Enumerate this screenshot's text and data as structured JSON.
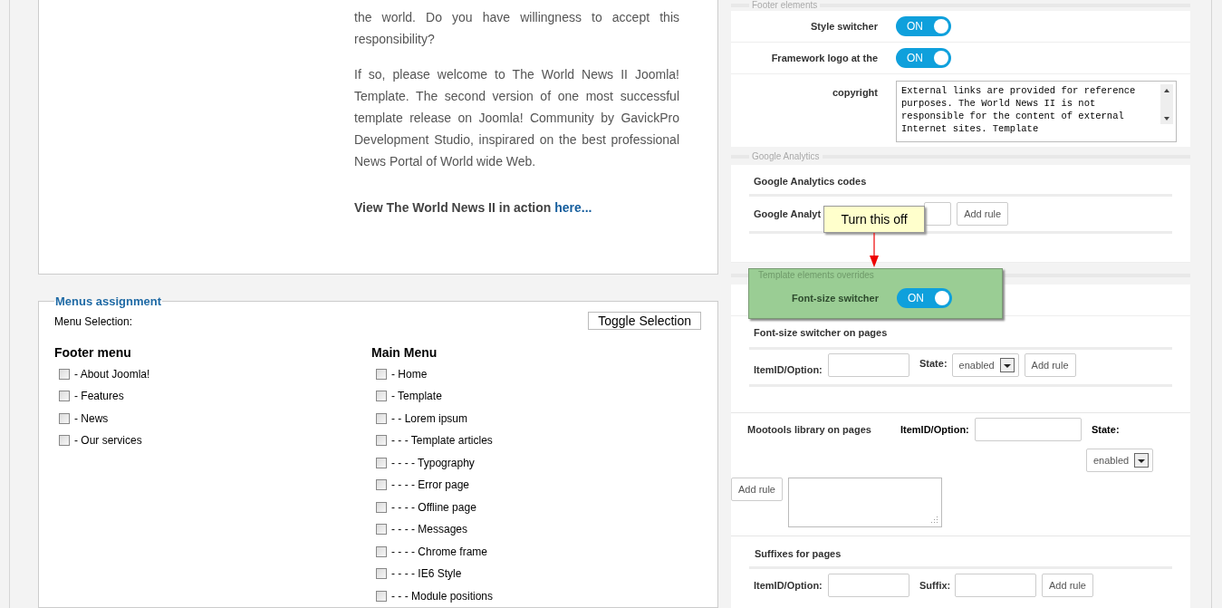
{
  "intro": {
    "paragraphs": [
      "the world. Do you have willingness to accept this responsibility?",
      "If so, please welcome to The World News II Joomla! Template. The second version of one most successful template release on Joomla! Community by GavickPro Development Studio, inspirared on the best professional News Portal of World wide Web."
    ],
    "cta": "View The World News II in action",
    "cta_link": "here..."
  },
  "menus_assignment": {
    "legend": "Menus assignment",
    "selection_label": "Menu Selection:",
    "toggle_button": "Toggle Selection",
    "menus": [
      {
        "title": "Footer menu",
        "items": [
          {
            "label": "- About Joomla!",
            "checked": false
          },
          {
            "label": "- Features",
            "checked": false
          },
          {
            "label": "- News",
            "checked": false
          },
          {
            "label": "- Our services",
            "checked": false
          }
        ]
      },
      {
        "title": "Main Menu",
        "items": [
          {
            "label": "- Home",
            "checked": false
          },
          {
            "label": "- Template",
            "checked": false
          },
          {
            "label": "- - Lorem ipsum",
            "checked": false
          },
          {
            "label": "- - - Template articles",
            "checked": false
          },
          {
            "label": "- - - - Typography",
            "checked": false
          },
          {
            "label": "- - - - Error page",
            "checked": false
          },
          {
            "label": "- - - - Offline page",
            "checked": false
          },
          {
            "label": "- - - - Messages",
            "checked": false
          },
          {
            "label": "- - - - Chrome frame",
            "checked": false
          },
          {
            "label": "- - - - IE6 Style",
            "checked": false
          },
          {
            "label": "- - - Module positions",
            "checked": false
          }
        ]
      }
    ]
  },
  "footer_elements": {
    "legend": "Footer elements",
    "toggles": [
      {
        "label": "Style switcher",
        "on": true,
        "text": "ON"
      },
      {
        "label": "Framework logo at the",
        "on": true,
        "text": "ON"
      }
    ],
    "copyright": {
      "label": "copyright",
      "value": "External links are provided for reference purposes. The World News II is not responsible for the content of external Internet sites. Template"
    }
  },
  "google_analytics": {
    "legend": "Google Analytics",
    "heading": "Google Analytics codes",
    "label": "Google Analyt",
    "button": "Add rule"
  },
  "tooltip": "Turn this off",
  "template_overrides": {
    "legend": "Template elements overrides",
    "toggle": {
      "label": "Font-size switcher",
      "on": true,
      "text": "ON"
    },
    "font_size_pages": {
      "heading": "Font-size switcher on pages",
      "item_label": "ItemID/Option:",
      "state_label": "State:",
      "state_value": "enabled",
      "button": "Add rule"
    },
    "mootools": {
      "heading": "Mootools library on pages",
      "item_label": "ItemID/Option:",
      "state_label": "State:",
      "state_value": "enabled",
      "button": "Add rule"
    },
    "suffixes": {
      "heading": "Suffixes for pages",
      "item_label": "ItemID/Option:",
      "suffix_label": "Suffix:",
      "button": "Add rule"
    }
  }
}
